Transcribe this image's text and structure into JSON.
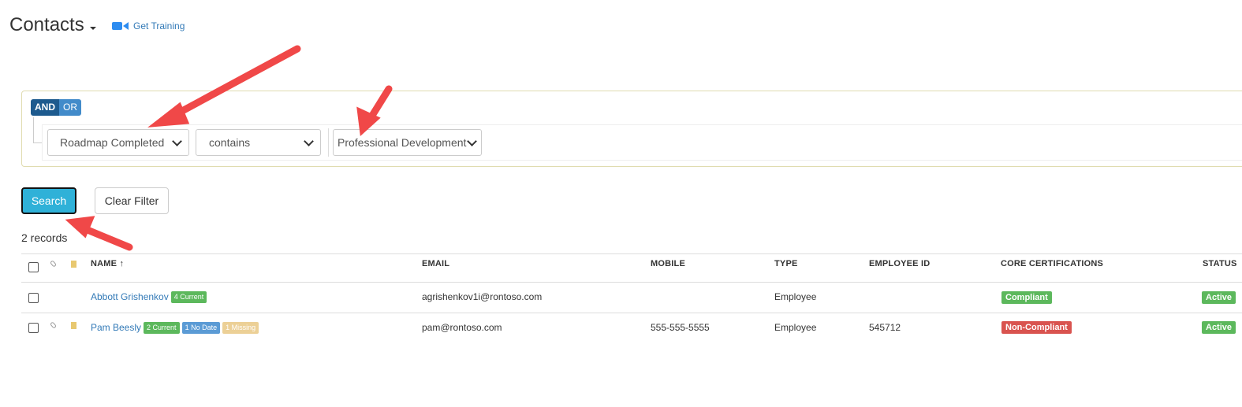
{
  "header": {
    "title": "Contacts",
    "training_label": "Get Training",
    "caret_icon": "caret-down-icon",
    "training_icon": "video-camera-icon"
  },
  "filter": {
    "and_label": "AND",
    "or_label": "OR",
    "field": "Roadmap Completed",
    "operator": "contains",
    "value": "Professional Development"
  },
  "actions": {
    "search_label": "Search",
    "clear_label": "Clear Filter"
  },
  "records_text": "2 records",
  "table": {
    "columns": {
      "name": "NAME ↑",
      "email": "EMAIL",
      "mobile": "MOBILE",
      "type": "TYPE",
      "employee_id": "EMPLOYEE ID",
      "core": "CORE CERTIFICATIONS",
      "status": "STATUS"
    },
    "rows": [
      {
        "name": "Abbott Grishenkov",
        "badges": [
          "4 Current"
        ],
        "email": "agrishenkov1i@rontoso.com",
        "mobile": "",
        "type": "Employee",
        "employee_id": "",
        "core": "Compliant",
        "status": "Active"
      },
      {
        "name": "Pam Beesly",
        "badges": [
          "2 Current",
          "1 No Date",
          "1 Missing"
        ],
        "email": "pam@rontoso.com",
        "mobile": "555-555-5555",
        "type": "Employee",
        "employee_id": "545712",
        "core": "Non-Compliant",
        "status": "Active"
      }
    ]
  },
  "colors": {
    "link": "#337ab7",
    "search_button": "#2fb1d8",
    "green_badge": "#5cb85c",
    "blue_badge": "#5b9bd5",
    "tan_badge": "#ecd096",
    "red_badge": "#d9534f",
    "annotation_arrow": "#f04848"
  }
}
